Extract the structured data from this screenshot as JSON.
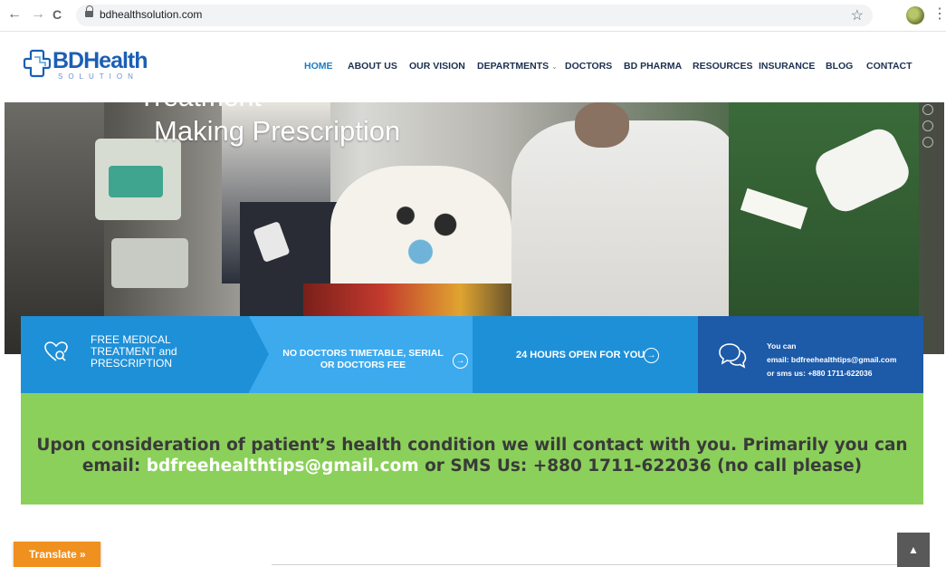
{
  "browser": {
    "url": "bdhealthsolution.com",
    "back_icon": "←",
    "forward_icon": "→",
    "reload_icon": "C",
    "star_icon": "☆",
    "menu_icon": "⋮"
  },
  "site": {
    "logo_text": "BDHealth",
    "logo_sub": "SOLUTION",
    "brand_color": "#1b5fb4"
  },
  "nav": {
    "items": [
      {
        "label": "HOME",
        "active": true
      },
      {
        "label": "ABOUT US"
      },
      {
        "label": "OUR VISION"
      },
      {
        "label": "DEPARTMENTS",
        "has_dropdown": true
      },
      {
        "label": "DOCTORS"
      },
      {
        "label": "BD PHARMA"
      },
      {
        "label": "RESOURCES"
      },
      {
        "label": "INSURANCE"
      },
      {
        "label": "BLOG"
      },
      {
        "label": "CONTACT"
      }
    ]
  },
  "hero": {
    "title_partial": "Treatment",
    "title": "Making Prescription"
  },
  "features": {
    "item1_lines": [
      "FREE MEDICAL",
      "TREATMENT and",
      "PRESCRIPTION"
    ],
    "item2_lines": [
      "NO DOCTORS TIMETABLE, SERIAL",
      "OR DOCTORS FEE"
    ],
    "item3": "24 HOURS OPEN FOR YOU",
    "item4_lines": [
      "You can",
      "email: bdfreehealthtips@gmail.com",
      "or sms us: +880 1711-622036"
    ],
    "arrow_icon": "→"
  },
  "banner": {
    "line1": "Upon consideration of patient’s health condition we will contact with you. Primarily you can",
    "line2_prefix": "email: ",
    "email": "bdfreehealthtips@gmail.com",
    "line2_suffix": " or SMS Us: +880 1711-622036 (no call please)"
  },
  "translate": {
    "label": "Translate »"
  },
  "to_top": {
    "icon": "▲"
  }
}
